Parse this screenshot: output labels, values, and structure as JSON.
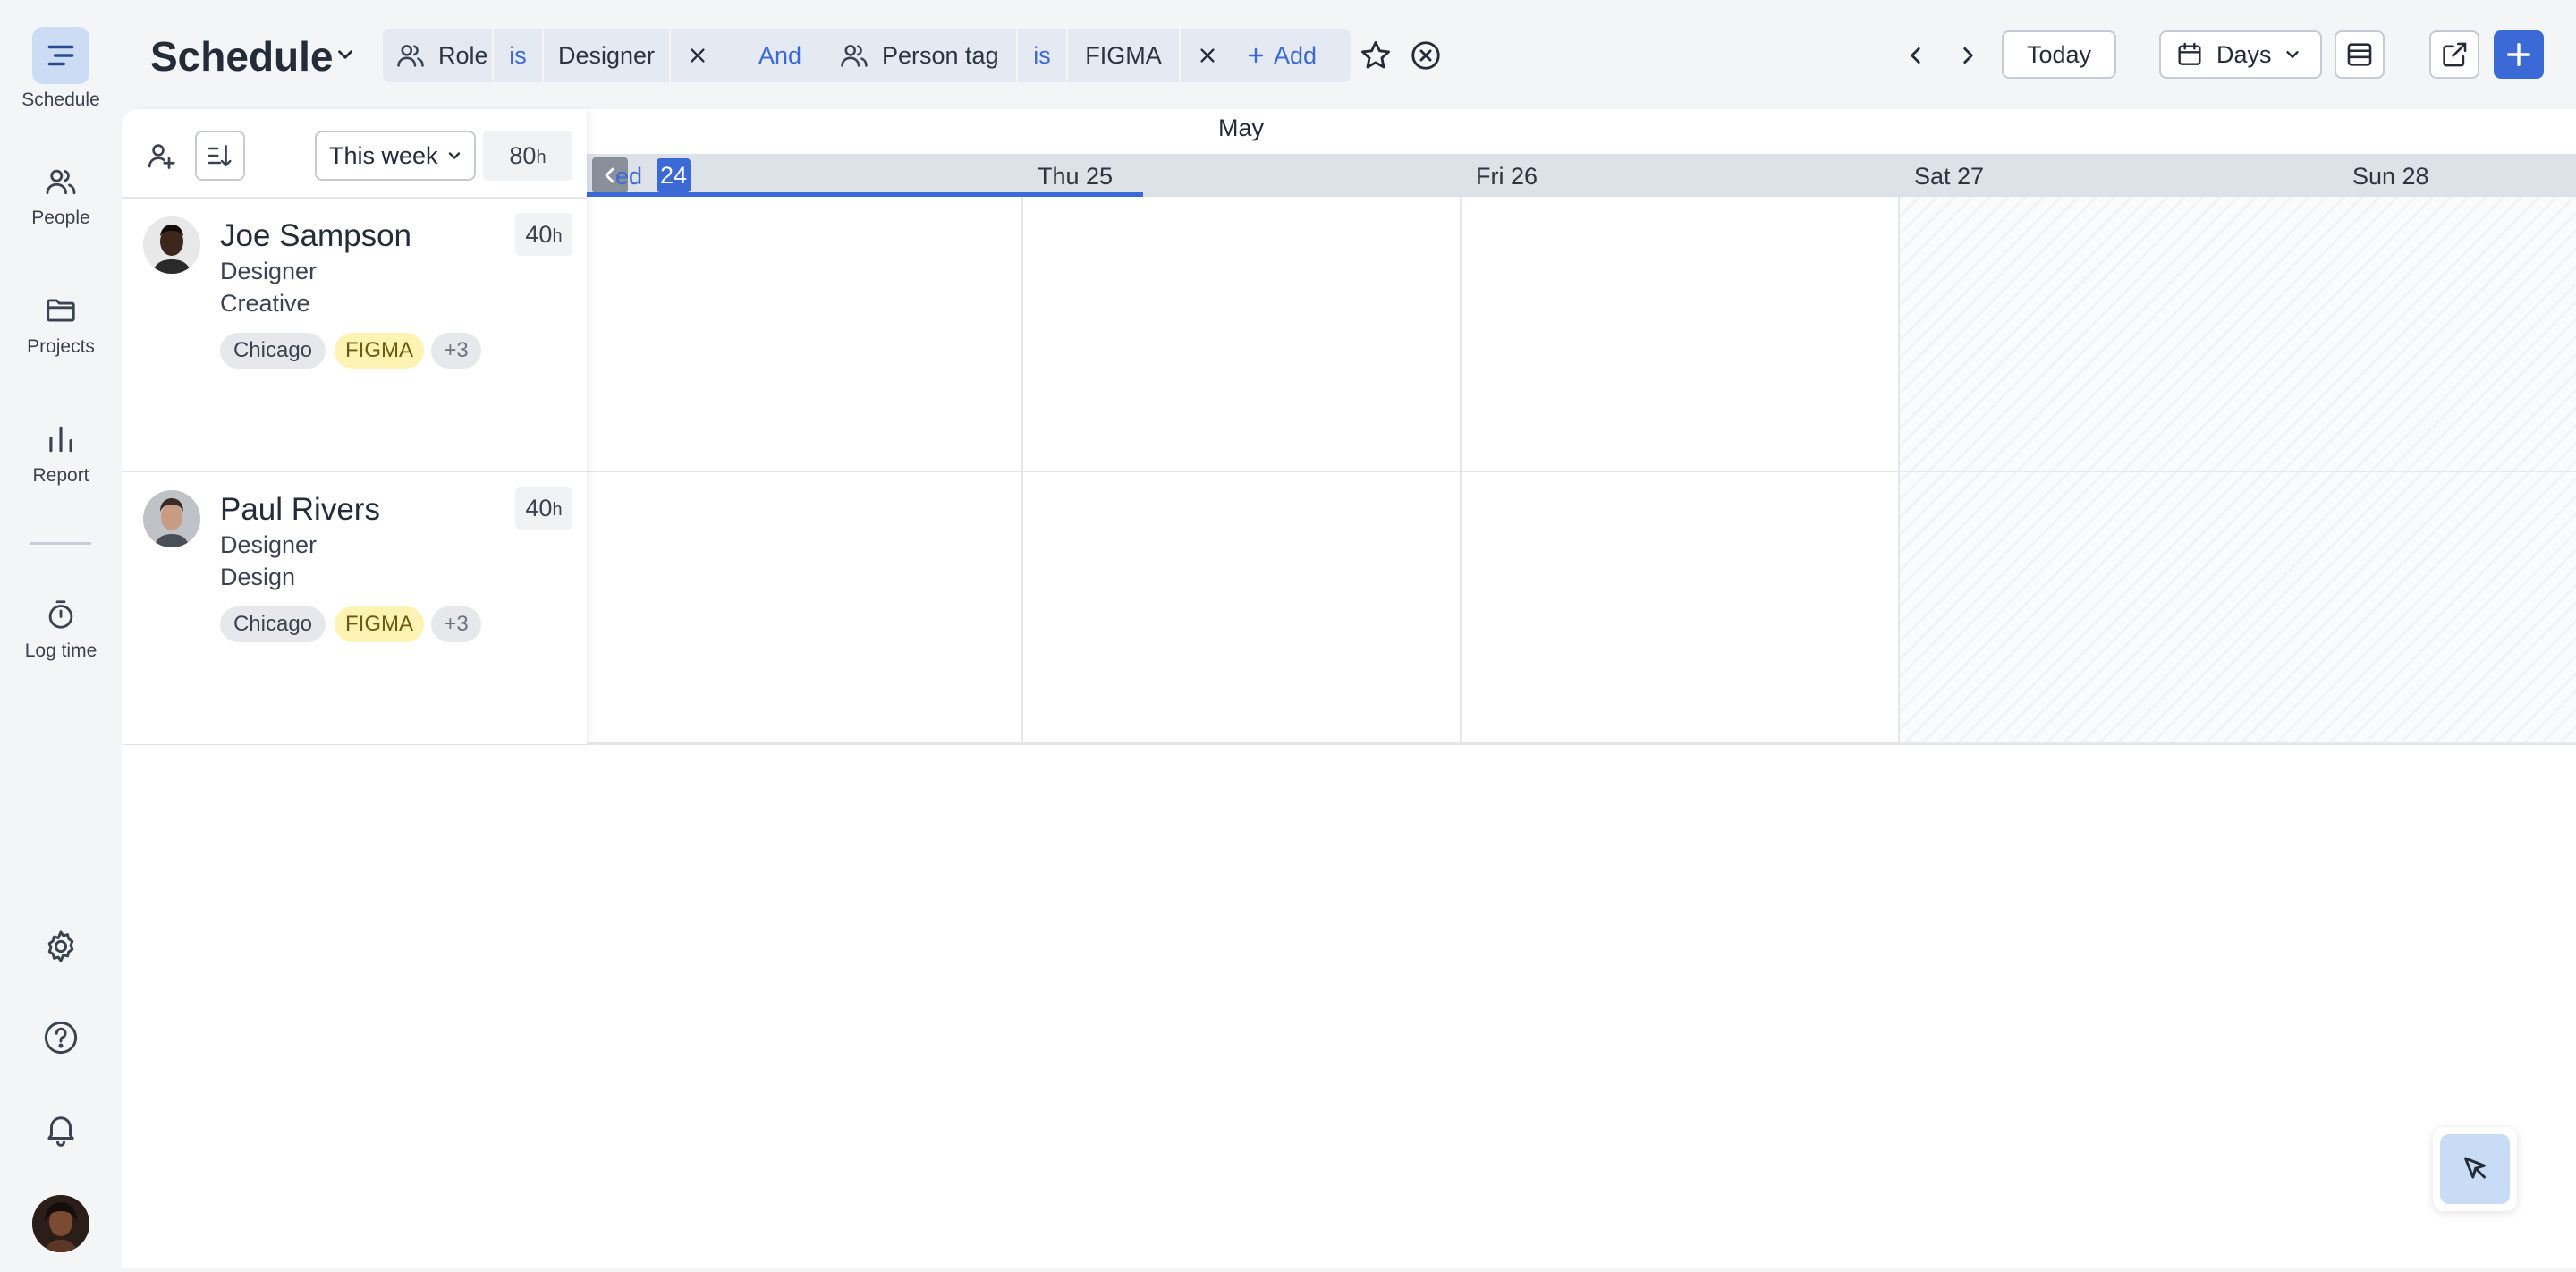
{
  "rail": {
    "items": [
      {
        "label": "Schedule",
        "icon": "schedule-icon"
      },
      {
        "label": "People",
        "icon": "people-icon"
      },
      {
        "label": "Projects",
        "icon": "folder-icon"
      },
      {
        "label": "Report",
        "icon": "bar-chart-icon"
      },
      {
        "label": "Log time",
        "icon": "timer-icon"
      }
    ],
    "bottom_icons": [
      "gear-icon",
      "help-icon",
      "bell-icon",
      "user-avatar"
    ]
  },
  "header": {
    "title": "Schedule",
    "filter1": {
      "field": "Role",
      "op": "is",
      "value": "Designer"
    },
    "conjunction": "And",
    "filter2": {
      "field": "Person tag",
      "op": "is",
      "value": "FIGMA"
    },
    "add_label": "Add",
    "today_label": "Today",
    "view_label": "Days"
  },
  "calendar": {
    "month": "May",
    "days": [
      {
        "label": "ed",
        "num": "24"
      },
      {
        "label": "Thu 25"
      },
      {
        "label": "Fri 26"
      },
      {
        "label": "Sat 27"
      },
      {
        "label": "Sun 28"
      }
    ]
  },
  "people_panel": {
    "range": "This week",
    "total_hours": "80",
    "hours_unit": "h",
    "people": [
      {
        "name": "Joe Sampson",
        "role": "Designer",
        "dept": "Creative",
        "hours": "40",
        "tags": [
          "Chicago",
          "FIGMA",
          "+3"
        ]
      },
      {
        "name": "Paul Rivers",
        "role": "Designer",
        "dept": "Design",
        "hours": "40",
        "tags": [
          "Chicago",
          "FIGMA",
          "+3"
        ]
      }
    ]
  },
  "colors": {
    "accent": "#3b6ad6",
    "chip_bg": "#e4e9f2",
    "active_rail": "#cddcf5",
    "tag_yellow": "#fdf4b3"
  }
}
